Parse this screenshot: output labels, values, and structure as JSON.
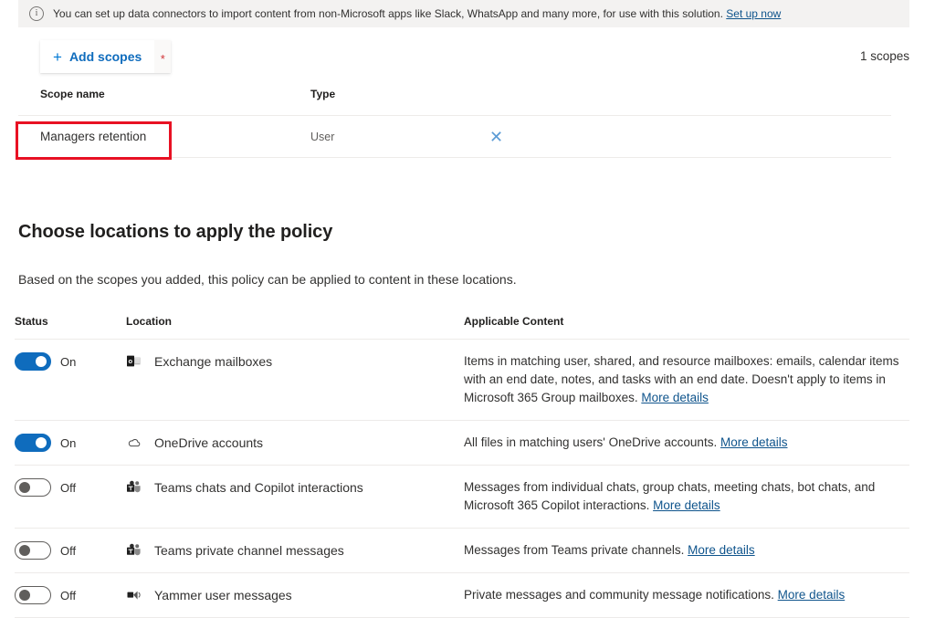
{
  "banner": {
    "icon": "info-icon",
    "text": "You can set up data connectors to import content from non-Microsoft apps like Slack, WhatsApp and many more, for use with this solution. ",
    "link_label": "Set up now"
  },
  "toolbar": {
    "add_scopes_label": "Add scopes",
    "plus_icon": "plus-icon",
    "required_marker": "*",
    "scopes_count": "1 scopes"
  },
  "scopes_table": {
    "headers": {
      "scope_name": "Scope name",
      "type": "Type"
    },
    "rows": [
      {
        "name": "Managers retention",
        "type": "User",
        "remove_icon": "close-icon",
        "highlighted": true
      }
    ]
  },
  "section": {
    "title": "Choose locations to apply the policy",
    "subtitle": "Based on the scopes you added, this policy can be applied to content in these locations."
  },
  "locations_table": {
    "headers": {
      "status": "Status",
      "location": "Location",
      "applicable_content": "Applicable Content"
    },
    "rows": [
      {
        "status": "On",
        "toggle_state": "on",
        "icon": "exchange-icon",
        "location": "Exchange mailboxes",
        "content": "Items in matching user, shared, and resource mailboxes: emails, calendar items with an end date, notes, and tasks with an end date. Doesn't apply to items in Microsoft 365 Group mailboxes. ",
        "content_link": "More details"
      },
      {
        "status": "On",
        "toggle_state": "on",
        "icon": "onedrive-icon",
        "location": "OneDrive accounts",
        "content": "All files in matching users' OneDrive accounts. ",
        "content_link": "More details"
      },
      {
        "status": "Off",
        "toggle_state": "off",
        "icon": "teams-icon",
        "location": "Teams chats and Copilot interactions",
        "content": "Messages from individual chats, group chats, meeting chats, bot chats, and Microsoft 365 Copilot interactions. ",
        "content_link": "More details"
      },
      {
        "status": "Off",
        "toggle_state": "off",
        "icon": "teams-icon",
        "location": "Teams private channel messages",
        "content": "Messages from Teams private channels. ",
        "content_link": "More details"
      },
      {
        "status": "Off",
        "toggle_state": "off",
        "icon": "yammer-icon",
        "location": "Yammer user messages",
        "content": "Private messages and community message notifications. ",
        "content_link": "More details"
      }
    ]
  },
  "colors": {
    "accent": "#0f6cbd",
    "link": "#0f548c",
    "required": "#d13438",
    "highlight_box": "#e81123",
    "banner_bg": "#f3f2f1"
  }
}
